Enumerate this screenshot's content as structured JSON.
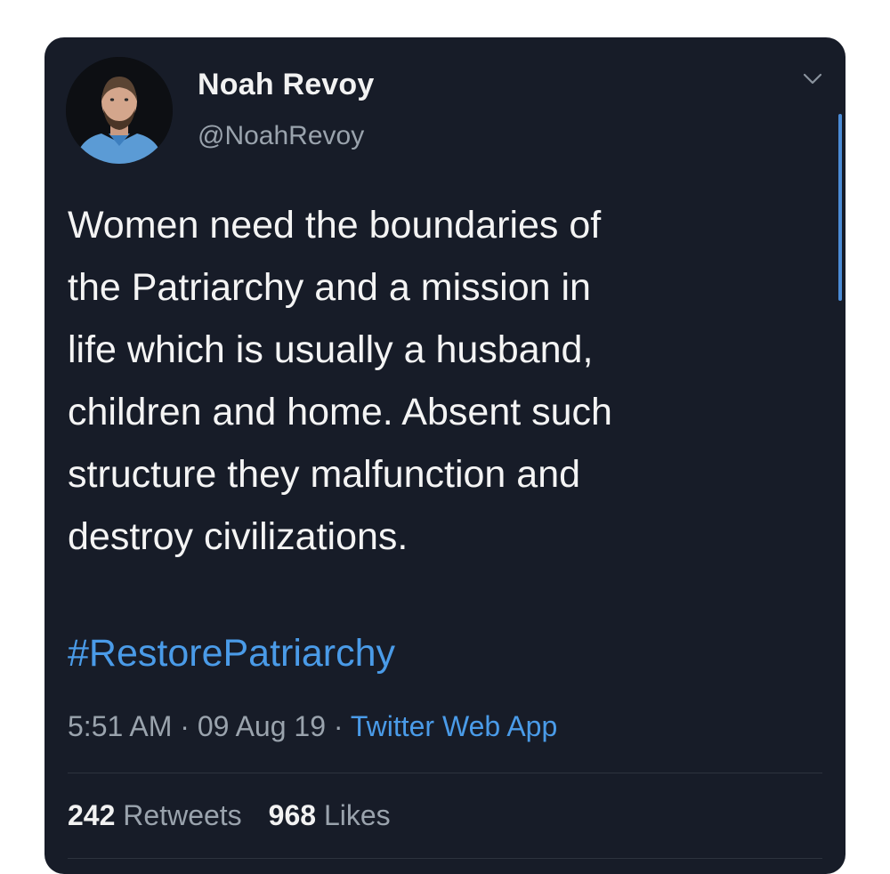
{
  "tweet": {
    "author": {
      "name": "Noah Revoy",
      "handle": "@NoahRevoy",
      "avatar_icon": "profile-photo"
    },
    "text_lines": [
      "Women need the boundaries of",
      "the Patriarchy and a mission in",
      "life which is usually a husband,",
      "children and home. Absent such",
      "structure they malfunction and",
      "destroy civilizations."
    ],
    "hashtag": "#RestorePatriarchy",
    "meta": {
      "time": "5:51 AM",
      "separator": "·",
      "date": "09 Aug 19",
      "source": "Twitter Web App"
    },
    "stats": {
      "retweets_count": "242",
      "retweets_label": "Retweets",
      "likes_count": "968",
      "likes_label": "Likes"
    }
  },
  "colors": {
    "card_background": "#171c28",
    "link_blue": "#4a9be8",
    "text_primary": "#f4f4f4",
    "text_secondary": "#9aa3ad"
  }
}
